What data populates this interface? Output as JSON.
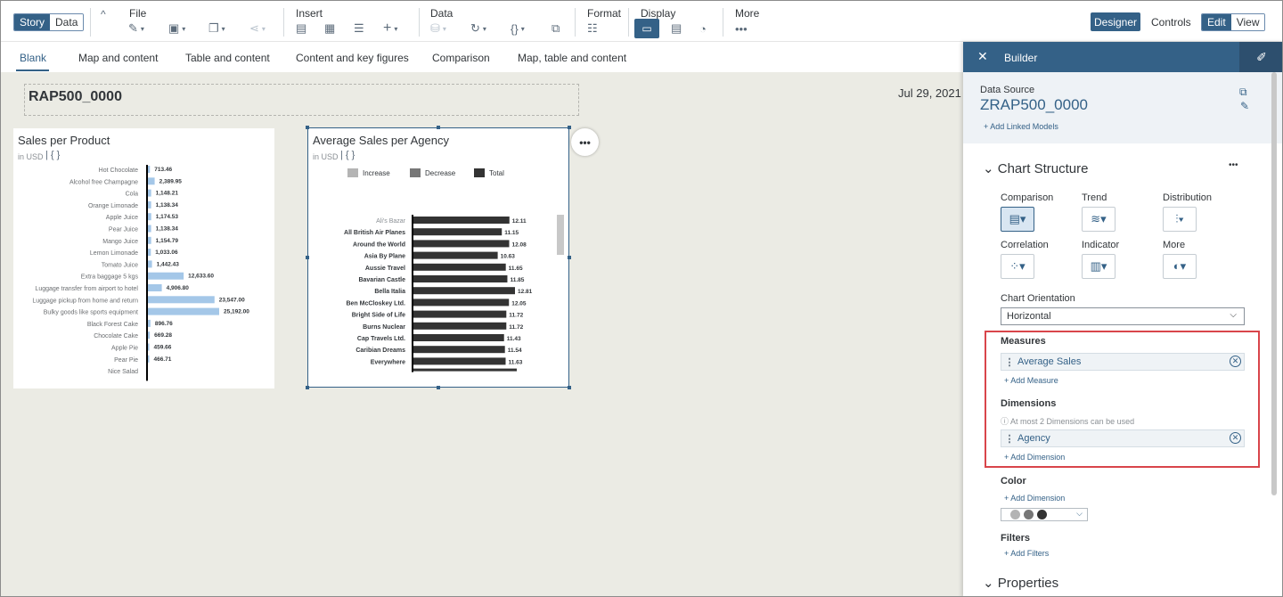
{
  "toolbar": {
    "mode_story": "Story",
    "mode_data": "Data",
    "file": "File",
    "insert": "Insert",
    "data": "Data",
    "format": "Format",
    "display": "Display",
    "more": "More",
    "designer": "Designer",
    "controls": "Controls",
    "edit": "Edit",
    "view": "View"
  },
  "tabs": [
    "Blank",
    "Map and content",
    "Table and content",
    "Content and key figures",
    "Comparison",
    "Map, table and content"
  ],
  "canvas": {
    "title": "RAP500_0000",
    "date": "Jul 29, 2021"
  },
  "chart_data": [
    {
      "type": "bar",
      "title": "Sales per Product",
      "subtitle": "in USD",
      "categories": [
        "Hot Chocolate",
        "Alcohol free Champagne",
        "Cola",
        "Orange Limonade",
        "Apple Juice",
        "Pear Juice",
        "Mango Juice",
        "Lemon Limonade",
        "Tomato Juice",
        "Extra baggage 5 kgs",
        "Luggage transfer from airport to hotel",
        "Luggage pickup from home and return",
        "Bulky goods like sports equipment",
        "Black Forest Cake",
        "Chocolate Cake",
        "Apple Pie",
        "Pear Pie",
        "Nice Salad"
      ],
      "values": [
        713.46,
        2389.95,
        1148.21,
        1138.34,
        1174.53,
        1138.34,
        1154.79,
        1033.06,
        1442.43,
        12633.6,
        4906.8,
        23547.0,
        25192.0,
        896.76,
        669.28,
        459.66,
        466.71,
        null
      ],
      "labels": [
        "713.46",
        "2,389.95",
        "1,148.21",
        "1,138.34",
        "1,174.53",
        "1,138.34",
        "1,154.79",
        "1,033.06",
        "1,442.43",
        "12,633.60",
        "4,906.80",
        "23,547.00",
        "25,192.00",
        "896.76",
        "669.28",
        "459.66",
        "466.71",
        ""
      ],
      "bar_color": "#a4c7e8"
    },
    {
      "type": "bar",
      "title": "Average Sales per Agency",
      "subtitle": "in USD",
      "legend": [
        "Increase",
        "Decrease",
        "Total"
      ],
      "legend_colors": [
        "#b4b4b4",
        "#777777",
        "#333333"
      ],
      "categories": [
        "Ali's Bazar",
        "All British Air Planes",
        "Around the World",
        "Asia By Plane",
        "Aussie Travel",
        "Bavarian Castle",
        "Bella Italia",
        "Ben McCloskey Ltd.",
        "Bright Side of Life",
        "Burns Nuclear",
        "Cap Travels Ltd.",
        "Caribian Dreams",
        "Everywhere"
      ],
      "values": [
        12.11,
        11.15,
        12.08,
        10.63,
        11.65,
        11.85,
        12.81,
        12.05,
        11.72,
        11.72,
        11.43,
        11.54,
        11.63
      ],
      "labels": [
        "12.11",
        "11.15",
        "12.08",
        "10.63",
        "11.65",
        "11.85",
        "12.81",
        "12.05",
        "11.72",
        "11.72",
        "11.43",
        "11.54",
        "11.63"
      ],
      "bar_color": "#333333"
    }
  ],
  "panel": {
    "title": "Builder",
    "data_source_label": "Data Source",
    "data_source": "ZRAP500_0000",
    "add_linked": "Add Linked Models",
    "chart_structure": "Chart Structure",
    "types": [
      "Comparison",
      "Trend",
      "Distribution",
      "Correlation",
      "Indicator",
      "More"
    ],
    "orientation_label": "Chart Orientation",
    "orientation_value": "Horizontal",
    "measures_label": "Measures",
    "measure_item": "Average Sales",
    "add_measure": "Add Measure",
    "dimensions_label": "Dimensions",
    "dim_info": "At most 2 Dimensions can be used",
    "dimension_item": "Agency",
    "add_dimension": "Add Dimension",
    "color_label": "Color",
    "color_add_dimension": "Add Dimension",
    "filters_label": "Filters",
    "add_filters": "Add Filters",
    "properties": "Properties"
  }
}
